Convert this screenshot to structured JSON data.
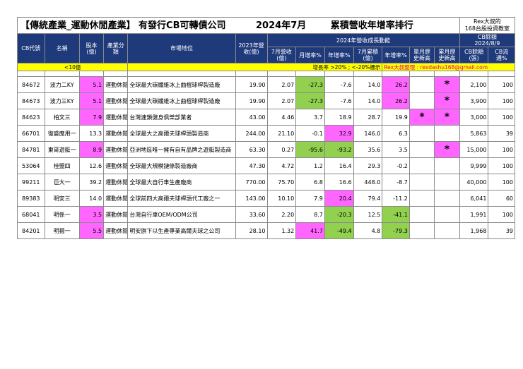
{
  "title": {
    "part1": "【傳統產業_運動休閒產業】 有發行CB可轉債公司",
    "part2": "2024年7月",
    "part3": "累積營收年增率排行"
  },
  "brand": {
    "line1": "Rex大叔的",
    "line2": "168台股投資教室"
  },
  "headers": {
    "cb_code": "CB代號",
    "name": "名稱",
    "capital": "股本(億)",
    "category": "產業分類",
    "market": "市場地位",
    "rev2023": "2023年營收(億)",
    "group_2024": "2024年營收成長動能",
    "cb_balance_title": "CB餘額",
    "cb_date": "2024/8/9",
    "rev_month": "7月營收(億)",
    "mom": "月增率%",
    "yoy": "年增率%",
    "cum": "7月累積(億)",
    "cum_yoy": "年增率%",
    "month_high": "單月歷史新高",
    "cum_high": "累月歷史新高",
    "cb_amount": "CB餘額(張)",
    "cb_float": "CB流通%"
  },
  "notes": {
    "left": "<10億",
    "mid": "增長率 >20% ; <-20%標示",
    "right": "Rex大叔整理 : rexdashu168@gmail.com"
  },
  "rows": [
    {
      "code": "84672",
      "name": "波力二KY",
      "capital": "5.1",
      "category": "運動休閒",
      "market": "全球最大碳纖維冰上曲棍球桿製造廠",
      "rev2023": "19.90",
      "rev_month": "2.07",
      "mom": "-27.3",
      "yoy": "-7.6",
      "cum": "14.0",
      "cum_yoy": "26.2",
      "month_high": "",
      "cum_high": "*",
      "cb_amount": "2,100",
      "cb_float": "100"
    },
    {
      "code": "84673",
      "name": "波力三KY",
      "capital": "5.1",
      "category": "運動休閒",
      "market": "全球最大碳纖維冰上曲棍球桿製造廠",
      "rev2023": "19.90",
      "rev_month": "2.07",
      "mom": "-27.3",
      "yoy": "-7.6",
      "cum": "14.0",
      "cum_yoy": "26.2",
      "month_high": "",
      "cum_high": "*",
      "cb_amount": "3,900",
      "cb_float": "100"
    },
    {
      "code": "84623",
      "name": "柏文三",
      "capital": "7.9",
      "category": "運動休閒",
      "market": "台灣連鎖健身俱樂部業者",
      "rev2023": "43.00",
      "rev_month": "4.46",
      "mom": "3.7",
      "yoy": "18.9",
      "cum": "28.7",
      "cum_yoy": "19.9",
      "month_high": "*",
      "cum_high": "*",
      "cb_amount": "3,000",
      "cb_float": "100"
    },
    {
      "code": "66701",
      "name": "復盛應用一",
      "capital": "13.3",
      "category": "運動休閒",
      "market": "全球最大之高爾夫球桿頭製造商",
      "rev2023": "244.00",
      "rev_month": "21.10",
      "mom": "-0.1",
      "yoy": "32.9",
      "cum": "146.0",
      "cum_yoy": "6.3",
      "month_high": "",
      "cum_high": "",
      "cb_amount": "5,863",
      "cb_float": "39"
    },
    {
      "code": "84781",
      "name": "東哥遊艇一",
      "capital": "8.9",
      "category": "運動休閒",
      "market": "亞洲地區唯一擁有自有品牌之遊艇製造商",
      "rev2023": "63.30",
      "rev_month": "0.27",
      "mom": "-95.6",
      "yoy": "-93.2",
      "cum": "35.6",
      "cum_yoy": "3.5",
      "month_high": "",
      "cum_high": "*",
      "cb_amount": "15,000",
      "cb_float": "100"
    },
    {
      "code": "53064",
      "name": "桂盟四",
      "capital": "12.6",
      "category": "運動休閒",
      "market": "全球最大規模鏈條製造廠商",
      "rev2023": "47.30",
      "rev_month": "4.72",
      "mom": "1.2",
      "yoy": "16.4",
      "cum": "29.3",
      "cum_yoy": "-0.2",
      "month_high": "",
      "cum_high": "",
      "cb_amount": "9,999",
      "cb_float": "100"
    },
    {
      "code": "99211",
      "name": "巨大一",
      "capital": "39.2",
      "category": "運動休閒",
      "market": "全球最大自行車生產廠商",
      "rev2023": "770.00",
      "rev_month": "75.70",
      "mom": "6.8",
      "yoy": "16.6",
      "cum": "448.0",
      "cum_yoy": "-8.7",
      "month_high": "",
      "cum_high": "",
      "cb_amount": "40,000",
      "cb_float": "100"
    },
    {
      "code": "89383",
      "name": "明安三",
      "capital": "14.0",
      "category": "運動休閒",
      "market": "全球前四大高爾夫球桿頭代工廠之一",
      "rev2023": "143.00",
      "rev_month": "10.10",
      "mom": "7.9",
      "yoy": "20.4",
      "cum": "79.4",
      "cum_yoy": "-11.2",
      "month_high": "",
      "cum_high": "",
      "cb_amount": "6,041",
      "cb_float": "60"
    },
    {
      "code": "68041",
      "name": "明係一",
      "capital": "3.5",
      "category": "運動休閒",
      "market": "台灣自行車OEM/ODM公司",
      "rev2023": "33.60",
      "rev_month": "2.20",
      "mom": "8.7",
      "yoy": "-20.3",
      "cum": "12.5",
      "cum_yoy": "-41.1",
      "month_high": "",
      "cum_high": "",
      "cb_amount": "1,991",
      "cb_float": "100"
    },
    {
      "code": "84201",
      "name": "明揚一",
      "capital": "5.5",
      "category": "運動休閒",
      "market": "明安旗下以生產專業高爾夫球之公司",
      "rev2023": "28.10",
      "rev_month": "1.32",
      "mom": "41.7",
      "yoy": "-49.4",
      "cum": "4.8",
      "cum_yoy": "-79.3",
      "month_high": "",
      "cum_high": "",
      "cb_amount": "1,968",
      "cb_float": "39"
    }
  ],
  "highlight": {
    "capital": [
      "pink",
      "pink",
      "pink",
      "",
      "pink",
      "",
      "",
      "",
      "pink",
      "pink"
    ],
    "mom": [
      "green",
      "green",
      "",
      "",
      "green",
      "",
      "",
      "",
      "",
      "pink"
    ],
    "yoy": [
      "",
      "",
      "",
      "pink",
      "green",
      "",
      "",
      "pink",
      "green",
      "green"
    ],
    "cum_yoy": [
      "pink",
      "pink",
      "",
      "",
      "",
      "",
      "",
      "",
      "green",
      "green"
    ],
    "month_high": [
      "",
      "",
      "pink",
      "",
      "",
      "",
      "",
      "",
      "",
      ""
    ],
    "cum_high": [
      "pink",
      "pink",
      "pink",
      "",
      "pink",
      "",
      "",
      "",
      "",
      ""
    ]
  },
  "colors": {
    "header_bg": "#1f3a7a",
    "pink": "#ff66ff",
    "green": "#92d050",
    "note_bg": "#ffff00",
    "note_text": "#e0008a"
  }
}
